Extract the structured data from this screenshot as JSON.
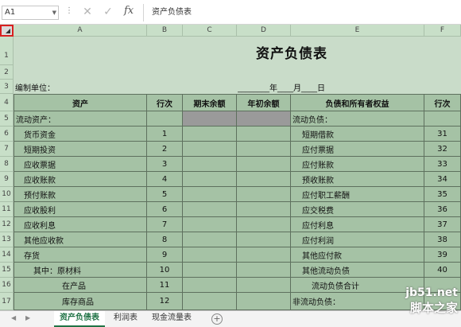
{
  "formula_bar": {
    "name_box": "A1",
    "cancel_icon": "x-icon",
    "confirm_icon": "check-icon",
    "fx_label": "fx",
    "content": "资产负债表"
  },
  "columns": [
    "A",
    "B",
    "C",
    "D",
    "E",
    "F"
  ],
  "rows": [
    "1",
    "2",
    "3",
    "4",
    "5",
    "6",
    "7",
    "8",
    "9",
    "10",
    "11",
    "12",
    "13",
    "14",
    "15",
    "16",
    "17"
  ],
  "sheet": {
    "title": "资产负债表",
    "unit_label": "编制单位：",
    "date_template": "________年____月____日",
    "headers": {
      "assets": "资产",
      "row_no": "行次",
      "end_balance": "期末余额",
      "begin_balance": "年初余额",
      "liabilities": "负债和所有者权益",
      "row_no_2": "行次"
    },
    "left_items": [
      {
        "label": "流动资产：",
        "num": ""
      },
      {
        "label": "货币资金",
        "num": "1"
      },
      {
        "label": "短期投资",
        "num": "2"
      },
      {
        "label": "应收票据",
        "num": "3"
      },
      {
        "label": "应收账款",
        "num": "4"
      },
      {
        "label": "预付账款",
        "num": "5"
      },
      {
        "label": "应收股利",
        "num": "6"
      },
      {
        "label": "应收利息",
        "num": "7"
      },
      {
        "label": "其他应收款",
        "num": "8"
      },
      {
        "label": "存货",
        "num": "9"
      },
      {
        "label": "其中：原材料",
        "num": "10"
      },
      {
        "label": "在产品",
        "num": "11"
      },
      {
        "label": "库存商品",
        "num": "12"
      }
    ],
    "right_items": [
      {
        "label": "流动负债：",
        "num": ""
      },
      {
        "label": "短期借款",
        "num": "31"
      },
      {
        "label": "应付票据",
        "num": "32"
      },
      {
        "label": "应付账款",
        "num": "33"
      },
      {
        "label": "预收账款",
        "num": "34"
      },
      {
        "label": "应付职工薪酬",
        "num": "35"
      },
      {
        "label": "应交税费",
        "num": "36"
      },
      {
        "label": "应付利息",
        "num": "37"
      },
      {
        "label": "应付利润",
        "num": "38"
      },
      {
        "label": "其他应付款",
        "num": "39"
      },
      {
        "label": "其他流动负债",
        "num": "40"
      },
      {
        "label": "流动负债合计",
        "num": ""
      },
      {
        "label": "非流动负债：",
        "num": ""
      }
    ]
  },
  "tabs": [
    {
      "label": "资产负债表",
      "active": true
    },
    {
      "label": "利润表",
      "active": false
    },
    {
      "label": "现金流量表",
      "active": false
    }
  ],
  "add_sheet": "+",
  "watermark": {
    "line1": "jb51.net",
    "line2": "脚本之家"
  },
  "colors": {
    "sheet_fill": "#a5c2a5",
    "header_fill": "#c8dfc8",
    "gray_cells": "#9a9a9a",
    "accent": "#217346",
    "corner_highlight": "#d82020"
  }
}
